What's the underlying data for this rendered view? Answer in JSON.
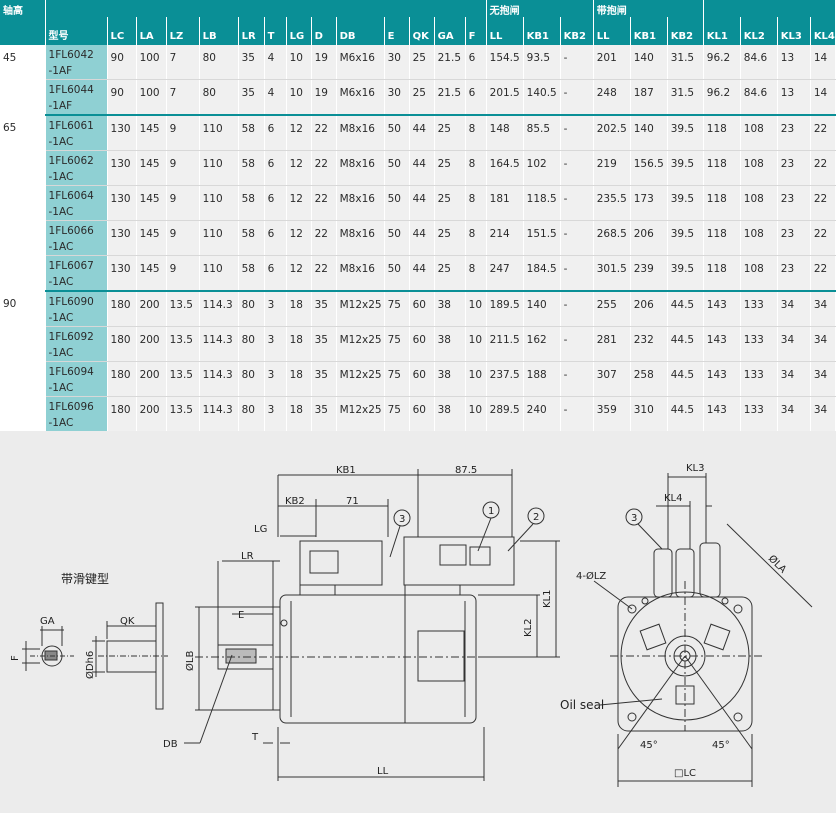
{
  "table": {
    "shaft_header": "轴高",
    "model_header": "型号",
    "group_no_brake": "无抱闸",
    "group_brake": "带抱闸",
    "columns": [
      "LC",
      "LA",
      "LZ",
      "LB",
      "LR",
      "T",
      "LG",
      "D",
      "DB",
      "E",
      "QK",
      "GA",
      "F",
      "LL",
      "KB1",
      "KB2",
      "LL",
      "KB1",
      "KB2",
      "KL1",
      "KL2",
      "KL3",
      "KL4"
    ],
    "groups": [
      {
        "shaft": "45",
        "rows": [
          {
            "model": [
              "1FL6042",
              "-1AF"
            ],
            "values": [
              "90",
              "100",
              "7",
              "80",
              "35",
              "4",
              "10",
              "19",
              "M6x16",
              "30",
              "25",
              "21.5",
              "6",
              "154.5",
              "93.5",
              "-",
              "201",
              "140",
              "31.5",
              "96.2",
              "84.6",
              "13",
              "14"
            ]
          },
          {
            "model": [
              "1FL6044",
              "-1AF"
            ],
            "values": [
              "90",
              "100",
              "7",
              "80",
              "35",
              "4",
              "10",
              "19",
              "M6x16",
              "30",
              "25",
              "21.5",
              "6",
              "201.5",
              "140.5",
              "-",
              "248",
              "187",
              "31.5",
              "96.2",
              "84.6",
              "13",
              "14"
            ]
          }
        ]
      },
      {
        "shaft": "65",
        "rows": [
          {
            "model": [
              "1FL6061",
              "-1AC"
            ],
            "values": [
              "130",
              "145",
              "9",
              "110",
              "58",
              "6",
              "12",
              "22",
              "M8x16",
              "50",
              "44",
              "25",
              "8",
              "148",
              "85.5",
              "-",
              "202.5",
              "140",
              "39.5",
              "118",
              "108",
              "23",
              "22"
            ]
          },
          {
            "model": [
              "1FL6062",
              "-1AC"
            ],
            "values": [
              "130",
              "145",
              "9",
              "110",
              "58",
              "6",
              "12",
              "22",
              "M8x16",
              "50",
              "44",
              "25",
              "8",
              "164.5",
              "102",
              "-",
              "219",
              "156.5",
              "39.5",
              "118",
              "108",
              "23",
              "22"
            ]
          },
          {
            "model": [
              "1FL6064",
              "-1AC"
            ],
            "values": [
              "130",
              "145",
              "9",
              "110",
              "58",
              "6",
              "12",
              "22",
              "M8x16",
              "50",
              "44",
              "25",
              "8",
              "181",
              "118.5",
              "-",
              "235.5",
              "173",
              "39.5",
              "118",
              "108",
              "23",
              "22"
            ]
          },
          {
            "model": [
              "1FL6066",
              "-1AC"
            ],
            "values": [
              "130",
              "145",
              "9",
              "110",
              "58",
              "6",
              "12",
              "22",
              "M8x16",
              "50",
              "44",
              "25",
              "8",
              "214",
              "151.5",
              "-",
              "268.5",
              "206",
              "39.5",
              "118",
              "108",
              "23",
              "22"
            ]
          },
          {
            "model": [
              "1FL6067",
              "-1AC"
            ],
            "values": [
              "130",
              "145",
              "9",
              "110",
              "58",
              "6",
              "12",
              "22",
              "M8x16",
              "50",
              "44",
              "25",
              "8",
              "247",
              "184.5",
              "-",
              "301.5",
              "239",
              "39.5",
              "118",
              "108",
              "23",
              "22"
            ]
          }
        ]
      },
      {
        "shaft": "90",
        "rows": [
          {
            "model": [
              "1FL6090",
              "-1AC"
            ],
            "values": [
              "180",
              "200",
              "13.5",
              "114.3",
              "80",
              "3",
              "18",
              "35",
              "M12x25",
              "75",
              "60",
              "38",
              "10",
              "189.5",
              "140",
              "-",
              "255",
              "206",
              "44.5",
              "143",
              "133",
              "34",
              "34"
            ]
          },
          {
            "model": [
              "1FL6092",
              "-1AC"
            ],
            "values": [
              "180",
              "200",
              "13.5",
              "114.3",
              "80",
              "3",
              "18",
              "35",
              "M12x25",
              "75",
              "60",
              "38",
              "10",
              "211.5",
              "162",
              "-",
              "281",
              "232",
              "44.5",
              "143",
              "133",
              "34",
              "34"
            ]
          },
          {
            "model": [
              "1FL6094",
              "-1AC"
            ],
            "values": [
              "180",
              "200",
              "13.5",
              "114.3",
              "80",
              "3",
              "18",
              "35",
              "M12x25",
              "75",
              "60",
              "38",
              "10",
              "237.5",
              "188",
              "-",
              "307",
              "258",
              "44.5",
              "143",
              "133",
              "34",
              "34"
            ]
          },
          {
            "model": [
              "1FL6096",
              "-1AC"
            ],
            "values": [
              "180",
              "200",
              "13.5",
              "114.3",
              "80",
              "3",
              "18",
              "35",
              "M12x25",
              "75",
              "60",
              "38",
              "10",
              "289.5",
              "240",
              "-",
              "359",
              "310",
              "44.5",
              "143",
              "133",
              "34",
              "34"
            ]
          }
        ]
      }
    ]
  },
  "drawing": {
    "key_type_label": "带滑键型",
    "labels": {
      "kb1": "KB1",
      "dim_875": "87.5",
      "kb2": "KB2",
      "dim_71": "71",
      "lg": "LG",
      "lr": "LR",
      "e": "E",
      "ga": "GA",
      "qk": "QK",
      "f": "F",
      "od": "ØDh6",
      "olb": "ØLB",
      "db": "DB",
      "t": "T",
      "ll": "LL",
      "kl2": "KL2",
      "kl1": "KL1",
      "kl3": "KL3",
      "kl4": "KL4",
      "ola": "ØLA",
      "lz": "4-ØLZ",
      "oil_seal": "Oil seal",
      "lc": "□LC",
      "deg45a": "45°",
      "deg45b": "45°",
      "c1": "1",
      "c2": "2",
      "c3": "3",
      "c3b": "3"
    }
  }
}
